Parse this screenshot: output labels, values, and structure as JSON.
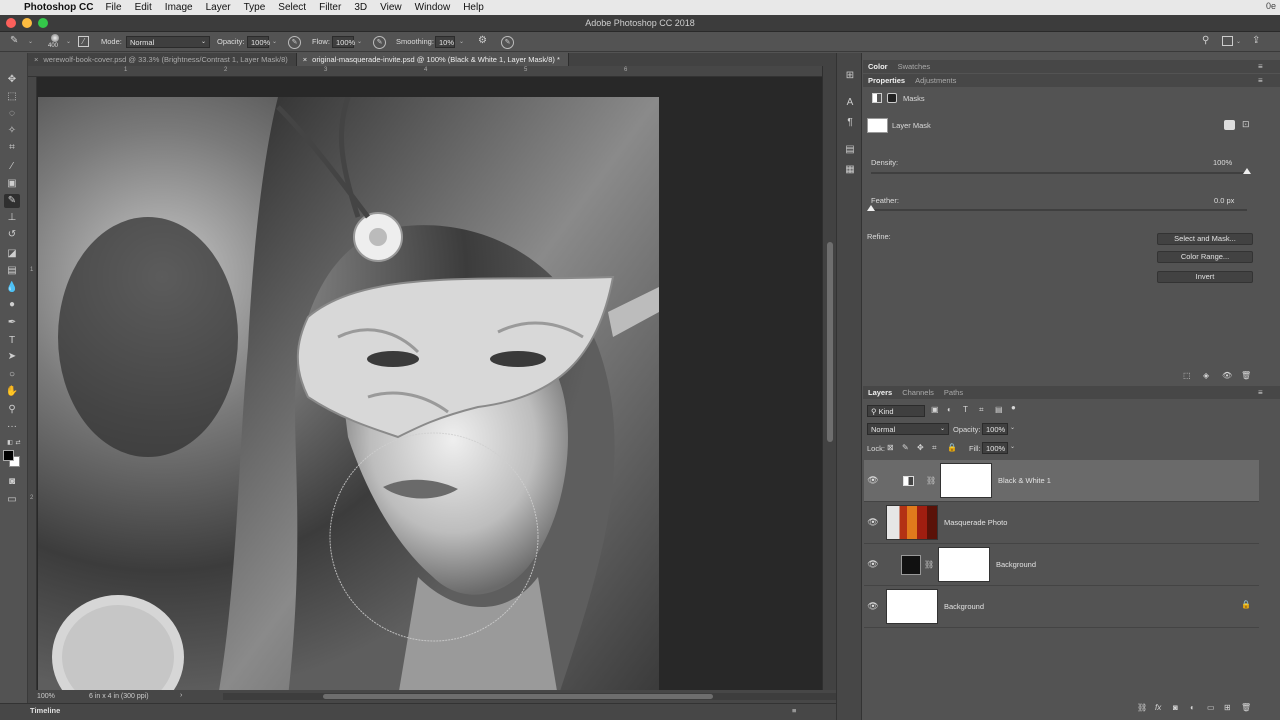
{
  "menubar": {
    "app_name": "Photoshop CC",
    "items": [
      "File",
      "Edit",
      "Image",
      "Layer",
      "Type",
      "Select",
      "Filter",
      "3D",
      "View",
      "Window",
      "Help"
    ],
    "right_text": "0e"
  },
  "window": {
    "title": "Adobe Photoshop CC 2018"
  },
  "options_bar": {
    "brush_size": "400",
    "mode_label": "Mode:",
    "mode_value": "Normal",
    "opacity_label": "Opacity:",
    "opacity_value": "100%",
    "flow_label": "Flow:",
    "flow_value": "100%",
    "smoothing_label": "Smoothing:",
    "smoothing_value": "10%"
  },
  "document_tabs": [
    {
      "label": "werewolf-book-cover.psd @ 33.3% (Brightness/Contrast 1, Layer Mask/8)",
      "active": false
    },
    {
      "label": "original-masquerade-invite.psd @ 100% (Black & White 1, Layer Mask/8) *",
      "active": true
    }
  ],
  "rulers": {
    "top_ticks": [
      "1",
      "2",
      "3",
      "4",
      "5",
      "6"
    ],
    "left_ticks": [
      "1",
      "2"
    ]
  },
  "status_bar": {
    "zoom": "100%",
    "doc_info": "6 in x 4 in (300 ppi)",
    "arrow": "›"
  },
  "timeline": {
    "label": "Timeline"
  },
  "panels": {
    "top_tabs": [
      {
        "label": "Color",
        "active": true
      },
      {
        "label": "Swatches",
        "active": false
      }
    ],
    "properties_tabs": [
      {
        "label": "Properties",
        "active": true
      },
      {
        "label": "Adjustments",
        "active": false
      }
    ],
    "properties": {
      "masks_label": "Masks",
      "layer_mask_label": "Layer Mask",
      "density_label": "Density:",
      "density_value": "100%",
      "density_level": 1.0,
      "feather_label": "Feather:",
      "feather_value": "0.0 px",
      "feather_level": 0.0,
      "refine_label": "Refine:",
      "buttons": [
        "Select and Mask...",
        "Color Range...",
        "Invert"
      ]
    },
    "layers_tabs": [
      {
        "label": "Layers",
        "active": true
      },
      {
        "label": "Channels",
        "active": false
      },
      {
        "label": "Paths",
        "active": false
      }
    ],
    "layers_controls": {
      "kind_label": "Kind",
      "blend_mode": "Normal",
      "opacity_label": "Opacity:",
      "opacity_value": "100%",
      "lock_label": "Lock:",
      "fill_label": "Fill:",
      "fill_value": "100%"
    },
    "layers": [
      {
        "name": "Black & White 1",
        "selected": true
      },
      {
        "name": "Masquerade Photo",
        "selected": false
      },
      {
        "name": "Background",
        "selected": false
      },
      {
        "name": "Background",
        "selected": false
      }
    ]
  },
  "colors": {
    "ui_dark": "#535353",
    "panel_bg": "#474747",
    "selected_layer": "#6a6a6a",
    "traffic_red": "#fc605b",
    "traffic_yellow": "#fdbc40",
    "traffic_green": "#34c84a"
  }
}
